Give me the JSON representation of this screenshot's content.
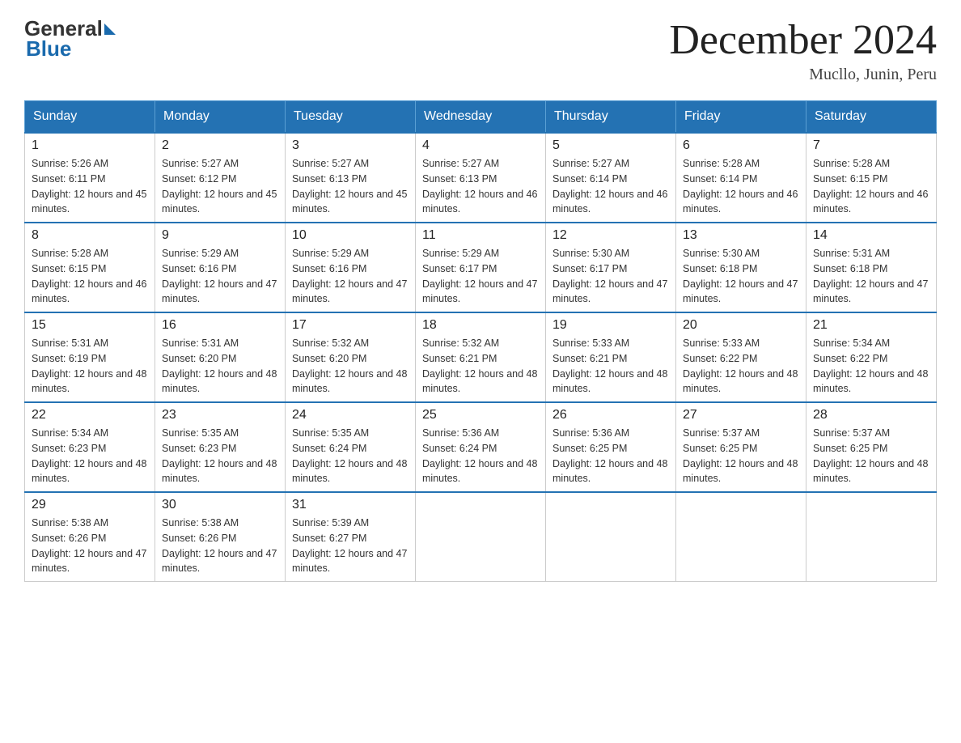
{
  "logo": {
    "general": "General",
    "blue": "Blue"
  },
  "header": {
    "title": "December 2024",
    "location": "Mucllo, Junin, Peru"
  },
  "days_of_week": [
    "Sunday",
    "Monday",
    "Tuesday",
    "Wednesday",
    "Thursday",
    "Friday",
    "Saturday"
  ],
  "weeks": [
    [
      {
        "day": "1",
        "sunrise": "Sunrise: 5:26 AM",
        "sunset": "Sunset: 6:11 PM",
        "daylight": "Daylight: 12 hours and 45 minutes."
      },
      {
        "day": "2",
        "sunrise": "Sunrise: 5:27 AM",
        "sunset": "Sunset: 6:12 PM",
        "daylight": "Daylight: 12 hours and 45 minutes."
      },
      {
        "day": "3",
        "sunrise": "Sunrise: 5:27 AM",
        "sunset": "Sunset: 6:13 PM",
        "daylight": "Daylight: 12 hours and 45 minutes."
      },
      {
        "day": "4",
        "sunrise": "Sunrise: 5:27 AM",
        "sunset": "Sunset: 6:13 PM",
        "daylight": "Daylight: 12 hours and 46 minutes."
      },
      {
        "day": "5",
        "sunrise": "Sunrise: 5:27 AM",
        "sunset": "Sunset: 6:14 PM",
        "daylight": "Daylight: 12 hours and 46 minutes."
      },
      {
        "day": "6",
        "sunrise": "Sunrise: 5:28 AM",
        "sunset": "Sunset: 6:14 PM",
        "daylight": "Daylight: 12 hours and 46 minutes."
      },
      {
        "day": "7",
        "sunrise": "Sunrise: 5:28 AM",
        "sunset": "Sunset: 6:15 PM",
        "daylight": "Daylight: 12 hours and 46 minutes."
      }
    ],
    [
      {
        "day": "8",
        "sunrise": "Sunrise: 5:28 AM",
        "sunset": "Sunset: 6:15 PM",
        "daylight": "Daylight: 12 hours and 46 minutes."
      },
      {
        "day": "9",
        "sunrise": "Sunrise: 5:29 AM",
        "sunset": "Sunset: 6:16 PM",
        "daylight": "Daylight: 12 hours and 47 minutes."
      },
      {
        "day": "10",
        "sunrise": "Sunrise: 5:29 AM",
        "sunset": "Sunset: 6:16 PM",
        "daylight": "Daylight: 12 hours and 47 minutes."
      },
      {
        "day": "11",
        "sunrise": "Sunrise: 5:29 AM",
        "sunset": "Sunset: 6:17 PM",
        "daylight": "Daylight: 12 hours and 47 minutes."
      },
      {
        "day": "12",
        "sunrise": "Sunrise: 5:30 AM",
        "sunset": "Sunset: 6:17 PM",
        "daylight": "Daylight: 12 hours and 47 minutes."
      },
      {
        "day": "13",
        "sunrise": "Sunrise: 5:30 AM",
        "sunset": "Sunset: 6:18 PM",
        "daylight": "Daylight: 12 hours and 47 minutes."
      },
      {
        "day": "14",
        "sunrise": "Sunrise: 5:31 AM",
        "sunset": "Sunset: 6:18 PM",
        "daylight": "Daylight: 12 hours and 47 minutes."
      }
    ],
    [
      {
        "day": "15",
        "sunrise": "Sunrise: 5:31 AM",
        "sunset": "Sunset: 6:19 PM",
        "daylight": "Daylight: 12 hours and 48 minutes."
      },
      {
        "day": "16",
        "sunrise": "Sunrise: 5:31 AM",
        "sunset": "Sunset: 6:20 PM",
        "daylight": "Daylight: 12 hours and 48 minutes."
      },
      {
        "day": "17",
        "sunrise": "Sunrise: 5:32 AM",
        "sunset": "Sunset: 6:20 PM",
        "daylight": "Daylight: 12 hours and 48 minutes."
      },
      {
        "day": "18",
        "sunrise": "Sunrise: 5:32 AM",
        "sunset": "Sunset: 6:21 PM",
        "daylight": "Daylight: 12 hours and 48 minutes."
      },
      {
        "day": "19",
        "sunrise": "Sunrise: 5:33 AM",
        "sunset": "Sunset: 6:21 PM",
        "daylight": "Daylight: 12 hours and 48 minutes."
      },
      {
        "day": "20",
        "sunrise": "Sunrise: 5:33 AM",
        "sunset": "Sunset: 6:22 PM",
        "daylight": "Daylight: 12 hours and 48 minutes."
      },
      {
        "day": "21",
        "sunrise": "Sunrise: 5:34 AM",
        "sunset": "Sunset: 6:22 PM",
        "daylight": "Daylight: 12 hours and 48 minutes."
      }
    ],
    [
      {
        "day": "22",
        "sunrise": "Sunrise: 5:34 AM",
        "sunset": "Sunset: 6:23 PM",
        "daylight": "Daylight: 12 hours and 48 minutes."
      },
      {
        "day": "23",
        "sunrise": "Sunrise: 5:35 AM",
        "sunset": "Sunset: 6:23 PM",
        "daylight": "Daylight: 12 hours and 48 minutes."
      },
      {
        "day": "24",
        "sunrise": "Sunrise: 5:35 AM",
        "sunset": "Sunset: 6:24 PM",
        "daylight": "Daylight: 12 hours and 48 minutes."
      },
      {
        "day": "25",
        "sunrise": "Sunrise: 5:36 AM",
        "sunset": "Sunset: 6:24 PM",
        "daylight": "Daylight: 12 hours and 48 minutes."
      },
      {
        "day": "26",
        "sunrise": "Sunrise: 5:36 AM",
        "sunset": "Sunset: 6:25 PM",
        "daylight": "Daylight: 12 hours and 48 minutes."
      },
      {
        "day": "27",
        "sunrise": "Sunrise: 5:37 AM",
        "sunset": "Sunset: 6:25 PM",
        "daylight": "Daylight: 12 hours and 48 minutes."
      },
      {
        "day": "28",
        "sunrise": "Sunrise: 5:37 AM",
        "sunset": "Sunset: 6:25 PM",
        "daylight": "Daylight: 12 hours and 48 minutes."
      }
    ],
    [
      {
        "day": "29",
        "sunrise": "Sunrise: 5:38 AM",
        "sunset": "Sunset: 6:26 PM",
        "daylight": "Daylight: 12 hours and 47 minutes."
      },
      {
        "day": "30",
        "sunrise": "Sunrise: 5:38 AM",
        "sunset": "Sunset: 6:26 PM",
        "daylight": "Daylight: 12 hours and 47 minutes."
      },
      {
        "day": "31",
        "sunrise": "Sunrise: 5:39 AM",
        "sunset": "Sunset: 6:27 PM",
        "daylight": "Daylight: 12 hours and 47 minutes."
      },
      null,
      null,
      null,
      null
    ]
  ]
}
